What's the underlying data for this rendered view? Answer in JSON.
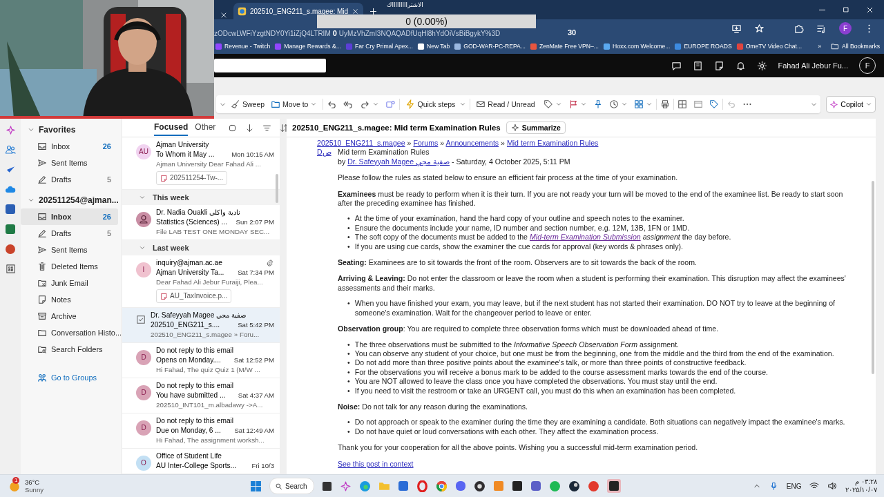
{
  "stream_overlay": {
    "banner": "الاشتراااااااااك",
    "counter": "0 (0.00%)",
    "scale_min": "0",
    "scale_max": "30"
  },
  "browser": {
    "tabs": [
      {
        "title": "202510_ENG211_s.magee: Mid",
        "selected": true
      }
    ],
    "url_parts": [
      "zODcwLWFiYzgtNDY0Yi1iZjQ4LTRIM",
      "UyMzVhZmI3NQAQADfUqHl8hYdOiVsBiBgykY%3D"
    ],
    "profile": "F",
    "bookmarks": [
      {
        "label": "Revenue - Twitch",
        "color": "#9146ff"
      },
      {
        "label": "Manage Rewards &...",
        "color": "#9146ff"
      },
      {
        "label": "Far Cry Primal Apex...",
        "color": "#5b3fd6"
      },
      {
        "label": "New Tab",
        "color": "#ffffff"
      },
      {
        "label": "GOD-WAR-PC-REPA...",
        "color": "#9ab8e0"
      },
      {
        "label": "ZenMate Free VPN–...",
        "color": "#e8553e"
      },
      {
        "label": "Hoxx.com Welcome...",
        "color": "#5aa9f0"
      },
      {
        "label": "EUROPE ROADS",
        "color": "#3d8be0"
      },
      {
        "label": "OmeTV Video Chat...",
        "color": "#e0443e"
      }
    ],
    "bookmarks_more": "»",
    "all_bookmarks": "All Bookmarks"
  },
  "outlook": {
    "user": "Fahad Ali Jebur Fu...",
    "avatar": "F",
    "ribbon": {
      "sweep": "Sweep",
      "move_to": "Move to",
      "quick_steps": "Quick steps",
      "read_unread": "Read / Unread",
      "copilot": "Copilot"
    },
    "folders": [
      {
        "title": "Favorites",
        "expanded": true,
        "items": [
          {
            "name": "Inbox",
            "kind": "inbox",
            "count": "26",
            "selected": false
          },
          {
            "name": "Sent Items",
            "kind": "sent",
            "selected": false
          },
          {
            "name": "Drafts",
            "kind": "drafts",
            "count": "5",
            "selected": false
          }
        ]
      },
      {
        "title": "202511254@ajman...",
        "expanded": true,
        "items": [
          {
            "name": "Inbox",
            "kind": "inbox",
            "count": "26",
            "selected": true
          },
          {
            "name": "Drafts",
            "kind": "drafts",
            "count": "5",
            "selected": false
          },
          {
            "name": "Sent Items",
            "kind": "sent",
            "selected": false
          },
          {
            "name": "Deleted Items",
            "kind": "trash",
            "selected": false
          },
          {
            "name": "Junk Email",
            "kind": "junk",
            "selected": false
          },
          {
            "name": "Notes",
            "kind": "notes",
            "selected": false
          },
          {
            "name": "Archive",
            "kind": "archive",
            "selected": false
          },
          {
            "name": "Conversation Histo...",
            "kind": "folder",
            "selected": false
          },
          {
            "name": "Search Folders",
            "kind": "search_folder",
            "selected": false
          }
        ]
      }
    ],
    "go_to_groups": "Go to Groups",
    "list_tabs": [
      {
        "label": "Focused",
        "selected": true
      },
      {
        "label": "Other",
        "selected": false
      }
    ],
    "entries": [
      {
        "kind": "message",
        "avatar": "AU",
        "color": "#f1d3f0",
        "sender": "Ajman University",
        "subject": "To Whom it May ...",
        "time": "Mon 10:15 AM",
        "preview": "Ajman University Dear Fahad Ali ...",
        "attachment": "202511254-Tw-...",
        "paperclip": false,
        "selected": false
      },
      {
        "kind": "group",
        "label": "This week",
        "expanded": true
      },
      {
        "kind": "message",
        "color": "#c98ea4",
        "sender": "Dr. Nadia Ouakli نادية واكلي",
        "subject": "Statistics (Sciences) ...",
        "time": "Sun 2:07 PM",
        "preview": "File LAB TEST ONE MONDAY SEC...",
        "paperclip": false,
        "selected": false
      },
      {
        "kind": "group",
        "label": "Last week",
        "expanded": true
      },
      {
        "kind": "message",
        "avatar": "I",
        "color": "#f0c2cf",
        "sender": "inquiry@ajman.ac.ae",
        "subject": "Ajman University Ta...",
        "time": "Sat 7:34 PM",
        "preview": "Dear Fahad Ali Jebur Furaiji, Plea...",
        "attachment": "AU_TaxInvoice.p...",
        "paperclip": true,
        "selected": false
      },
      {
        "kind": "message",
        "sender": "Dr. Safeyyah Magee صفية مجي",
        "subject": "202510_ENG211_s....",
        "time": "Sat 5:42 PM",
        "preview": "202510_ENG211_s.magee » Foru...",
        "paperclip": false,
        "selected": true
      },
      {
        "kind": "message",
        "avatar": "D",
        "color": "#d9a3b6",
        "sender": "Do not reply to this email",
        "subject": "Opens on Monday....",
        "time": "Sat 12:52 PM",
        "preview": "Hi Fahad, The quiz Quiz 1 (M/W ...",
        "paperclip": false,
        "selected": false
      },
      {
        "kind": "message",
        "avatar": "D",
        "color": "#d9a3b6",
        "sender": "Do not reply to this email",
        "subject": "You have submitted ...",
        "time": "Sat 4:37 AM",
        "preview": "202510_INT101_m.albadawy ->A...",
        "paperclip": false,
        "selected": false
      },
      {
        "kind": "message",
        "avatar": "D",
        "color": "#d9a3b6",
        "sender": "Do not reply to this email",
        "subject": "Due on Monday, 6 ...",
        "time": "Sat 12:49 AM",
        "preview": "Hi Fahad, The assignment worksh...",
        "paperclip": false,
        "selected": false
      },
      {
        "kind": "message",
        "avatar": "O",
        "color": "#c3e0f4",
        "sender": "Office of Student Life",
        "subject": "AU Inter-College Sports...",
        "time": "Fri 10/3",
        "paperclip": false,
        "selected": false
      }
    ],
    "reading": {
      "title": "202510_ENG211_s.magee: Mid term Examination Rules",
      "summarize": "Summarize",
      "breadcrumb": [
        "202510_ENG211_s.magee",
        "Forums",
        "Announcements",
        "Mid term Examination Rules"
      ],
      "breadcrumb_separator": "»",
      "author_picture": "Dص",
      "post_title": "Mid term Examination Rules",
      "byline": [
        {
          "kind": "text",
          "text": "by "
        },
        {
          "kind": "link",
          "text": "Dr. Safeyyah Magee صفية مجي"
        },
        {
          "kind": "text",
          "text": " - Saturday, 4 October 2025, 5:11 PM"
        }
      ],
      "bullet": "•",
      "blocks": [
        {
          "kind": "para",
          "segments": [
            {
              "kind": "text",
              "text": "Please follow the rules as stated below to ensure an efficient fair process at the time of your examination."
            }
          ]
        },
        {
          "kind": "para",
          "segments": [
            {
              "kind": "text",
              "text": "**Examinees** must be ready to perform when it is their turn.  If you are not ready your turn will be moved to the end of the examinee list.  Be ready to start soon after the preceding examinee has finished."
            }
          ]
        },
        {
          "kind": "list",
          "items": [
            [
              {
                "kind": "text",
                "text": "At the time of your examination, hand the hard copy of your outline and speech notes to the examiner."
              }
            ],
            [
              {
                "kind": "text",
                "text": "Ensure the documents include your name, ID number and section number, e.g. 12M, 13B, 1FN or 1MD."
              }
            ],
            [
              {
                "kind": "text",
                "text": "The soft copy of the documents must be added to the "
              },
              {
                "kind": "link",
                "text": "Mid-term Examination Submission"
              },
              {
                "kind": "text",
                "text": " *assignment* the day before."
              }
            ],
            [
              {
                "kind": "text",
                "text": "If you are using cue cards, show the examiner the cue cards for approval (key words & phrases only)."
              }
            ]
          ]
        },
        {
          "kind": "para",
          "segments": [
            {
              "kind": "text",
              "text": "**Seating:** Examinees are to sit towards the front of the room.  Observers are to sit towards the back of the room."
            }
          ]
        },
        {
          "kind": "para",
          "segments": [
            {
              "kind": "text",
              "text": "**Arriving & Leaving:**  Do not enter the classroom or leave the room when a student is performing their examination. This disruption may affect the examinees' assessments and their marks."
            }
          ]
        },
        {
          "kind": "list",
          "items": [
            [
              {
                "kind": "text",
                "text": "When you have finished your exam, you may leave, but if the next student has not started their examination.  DO NOT try to leave at the beginning of someone's examination. Wait for the changeover period to leave or enter."
              }
            ]
          ]
        },
        {
          "kind": "para",
          "segments": [
            {
              "kind": "text",
              "text": "**Observation group**: You are required to complete three observation forms which must be downloaded ahead of time."
            }
          ]
        },
        {
          "kind": "list",
          "items": [
            [
              {
                "kind": "text",
                "text": "The three observations must be submitted to the *Informative Speech Observation Form* assignment."
              }
            ],
            [
              {
                "kind": "text",
                "text": "You can observe any student of your choice, but one must be from the beginning, one from the middle and the third from the end of the examination."
              }
            ],
            [
              {
                "kind": "text",
                "text": "Do not add more than three positive points about the examinee's talk, or more than three points of constructive feedback."
              }
            ],
            [
              {
                "kind": "text",
                "text": "For the observations you will receive a bonus mark to be added to the course assessment marks towards the end of the course."
              }
            ],
            [
              {
                "kind": "text",
                "text": "You are NOT allowed to leave the class once you have completed the observations.  You must stay until the end."
              }
            ],
            [
              {
                "kind": "text",
                "text": "If you need to visit the restroom or take an URGENT call, you must do this when an examination has been completed."
              }
            ]
          ]
        },
        {
          "kind": "para",
          "segments": [
            {
              "kind": "text",
              "text": "**Noise:**  Do not talk for any reason during the examinations."
            }
          ]
        },
        {
          "kind": "list",
          "items": [
            [
              {
                "kind": "text",
                "text": "Do not approach or speak to the examiner during the time they are examining a candidate. Both situations can negatively impact the examinee's marks."
              }
            ],
            [
              {
                "kind": "text",
                "text": "Do not have quiet or loud conversations with each other.  They affect the examination process."
              }
            ]
          ]
        },
        {
          "kind": "para",
          "segments": [
            {
              "kind": "text",
              "text": "Thank you for your cooperation for all the above points.  Wishing you a successful mid-term examination period."
            }
          ]
        }
      ],
      "context_link": "See this post in context"
    }
  },
  "taskbar": {
    "weather": {
      "temperature": "36°C",
      "condition": "Sunny",
      "badge": "1"
    },
    "search": "Search",
    "language": "ENG",
    "time": "٠٣:٢٨ م",
    "date": "٢٠٢٥/١٠/٠٧"
  }
}
